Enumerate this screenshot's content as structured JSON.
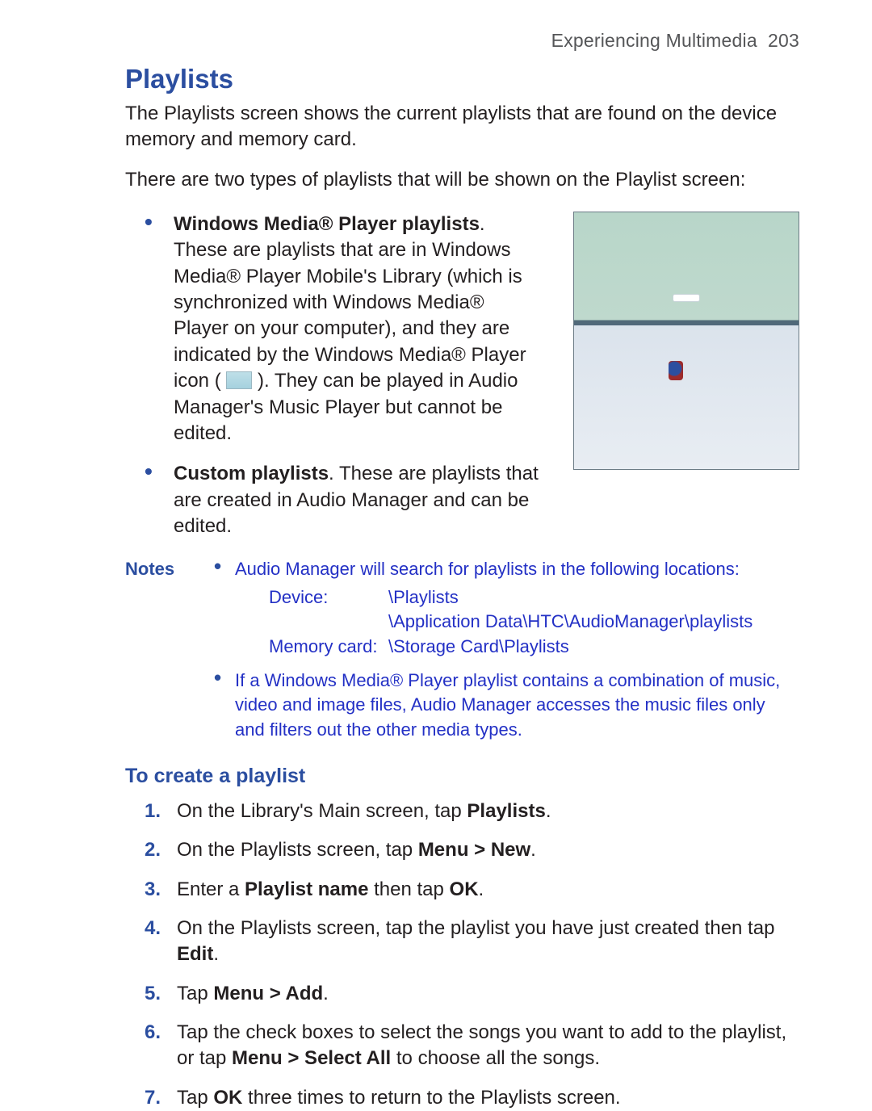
{
  "runHead": {
    "chapter": "Experiencing Multimedia",
    "page": "203"
  },
  "title": "Playlists",
  "intro1": "The Playlists screen shows the current playlists that are found on the device memory and memory card.",
  "intro2": "There are two types of playlists that will be shown on the Playlist screen:",
  "bullets": {
    "wmp_b": "Windows Media® Player playlists",
    "wmp_1": ". These are playlists that are in Windows Media® Player Mobile's Library (which is synchronized with Windows Media® Player on your computer), and they are indicated by the Windows Media® Player icon (",
    "wmp_2": "). They can be played in Audio Manager's Music Player but cannot be edited.",
    "custom_b": "Custom playlists",
    "custom_1": ". These are playlists that are created in Audio Manager and can be edited."
  },
  "notes": {
    "label": "Notes",
    "n1": "Audio Manager will search for playlists in the following locations:",
    "paths": {
      "device_k": "Device:",
      "device_v1": "\\Playlists",
      "device_v2": "\\Application Data\\HTC\\AudioManager\\playlists",
      "card_k": "Memory card:",
      "card_v": "\\Storage Card\\Playlists"
    },
    "n2": "If a Windows Media® Player playlist contains a combination of music, video and image files, Audio Manager accesses the music files only and filters out the other media types."
  },
  "howto": {
    "title": "To create a playlist",
    "s1a": "On the Library's Main screen, tap ",
    "s1b": "Playlists",
    "s1c": ".",
    "s2a": "On the Playlists screen, tap ",
    "s2b": "Menu > New",
    "s2c": ".",
    "s3a": "Enter a ",
    "s3b": "Playlist name",
    "s3c": " then tap ",
    "s3d": "OK",
    "s3e": ".",
    "s4a": "On the Playlists screen, tap the playlist you have just created then tap ",
    "s4b": "Edit",
    "s4c": ".",
    "s5a": "Tap ",
    "s5b": "Menu > Add",
    "s5c": ".",
    "s6a": "Tap the check boxes to select the songs you want to add to the playlist, or tap ",
    "s6b": "Menu > Select All",
    "s6c": " to choose all the songs.",
    "s7a": "Tap ",
    "s7b": "OK",
    "s7c": " three times to return to the Playlists screen."
  }
}
